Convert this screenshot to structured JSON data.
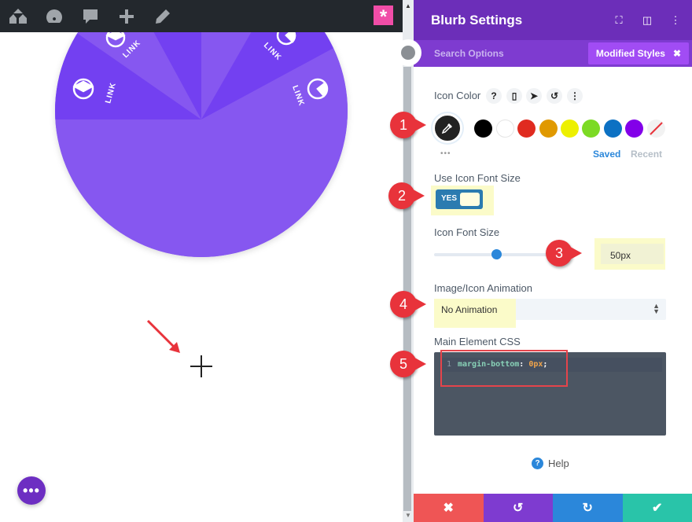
{
  "toolbar": {
    "icons": [
      "sitemap-icon",
      "dashboard-icon",
      "comments-icon",
      "add-new-icon",
      "edit-icon"
    ],
    "brand_icon": "divi-asterisk-icon"
  },
  "canvas": {
    "pie_labels": [
      "LINK",
      "LINK",
      "LINK",
      "LINK"
    ],
    "fab_label": "•••",
    "colors": {
      "pie_light": "#8657f0",
      "pie_dark": "#7340f1"
    }
  },
  "panel": {
    "title": "Blurb Settings",
    "header_icons": [
      "fullscreen-icon",
      "sidebar-icon",
      "more-icon"
    ],
    "search_placeholder": "Search Options",
    "filter_badge": "Modified Styles",
    "icon_color": {
      "label": "Icon Color",
      "tool_icons": [
        "?",
        "mobile",
        "cursor",
        "reset",
        "more"
      ],
      "swatches": [
        "#000000",
        "#ffffff",
        "#e02b20",
        "#e09900",
        "#edf000",
        "#7cda24",
        "#0c71c3",
        "#8300e9"
      ],
      "saved_label": "Saved",
      "recent_label": "Recent"
    },
    "use_icon_font_size": {
      "label": "Use Icon Font Size",
      "value": "YES"
    },
    "icon_font_size": {
      "label": "Icon Font Size",
      "value": "50px",
      "slider_fraction": 0.53
    },
    "animation": {
      "label": "Image/Icon Animation",
      "value": "No Animation"
    },
    "css": {
      "label": "Main Element CSS",
      "line_number": "1",
      "property": "margin-bottom",
      "value": "0px"
    },
    "help_label": "Help",
    "footer": {
      "cancel": "✖",
      "undo": "↺",
      "redo": "↻",
      "save": "✔"
    },
    "footer_colors": [
      "#ef5555",
      "#7e3bd0",
      "#2b87da",
      "#29c4a9"
    ]
  },
  "annotations": [
    "1",
    "2",
    "3",
    "4",
    "5"
  ]
}
